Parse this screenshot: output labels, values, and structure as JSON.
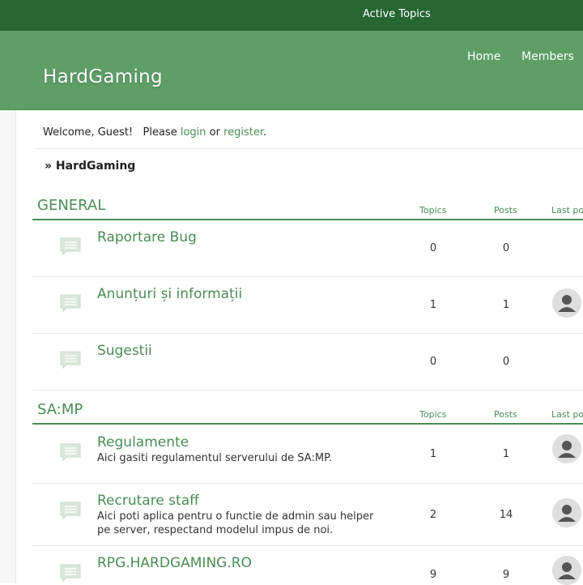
{
  "topbar": {
    "active_topics": "Active Topics"
  },
  "header": {
    "site_title": "HardGaming",
    "nav": {
      "home": "Home",
      "members": "Members"
    }
  },
  "welcome": {
    "prefix": "Welcome, Guest!   Please ",
    "login": "login",
    "or": " or ",
    "register": "register",
    "suffix": "."
  },
  "breadcrumb": "» HardGaming",
  "columns": {
    "topics": "Topics",
    "posts": "Posts",
    "last_post": "Last post"
  },
  "categories": [
    {
      "name": "GENERAL",
      "forums": [
        {
          "title": "Raportare Bug",
          "description": "",
          "topics": "0",
          "posts": "0",
          "has_last_post": false
        },
        {
          "title": "Anunțuri și informații",
          "description": "",
          "topics": "1",
          "posts": "1",
          "has_last_post": true
        },
        {
          "title": "Sugestii",
          "description": "",
          "topics": "0",
          "posts": "0",
          "has_last_post": false
        }
      ]
    },
    {
      "name": "SA:MP",
      "forums": [
        {
          "title": "Regulamente",
          "description": "Aici gasiti regulamentul serverului de SA:MP.",
          "topics": "1",
          "posts": "1",
          "has_last_post": true
        },
        {
          "title": "Recrutare staff",
          "description": "Aici poti aplica pentru o functie de admin sau helper pe server, respectand modelul impus de noi.",
          "topics": "2",
          "posts": "14",
          "has_last_post": true
        },
        {
          "title": "RPG.HARDGAMING.RO",
          "description": "",
          "topics": "9",
          "posts": "9",
          "has_last_post": true
        }
      ]
    }
  ],
  "colors": {
    "top_bar": "#256633",
    "header": "#5e9e67",
    "accent": "#4a8c55"
  },
  "icons": {
    "forum": "speech-bubble-icon",
    "avatar": "default-user-avatar-icon"
  }
}
